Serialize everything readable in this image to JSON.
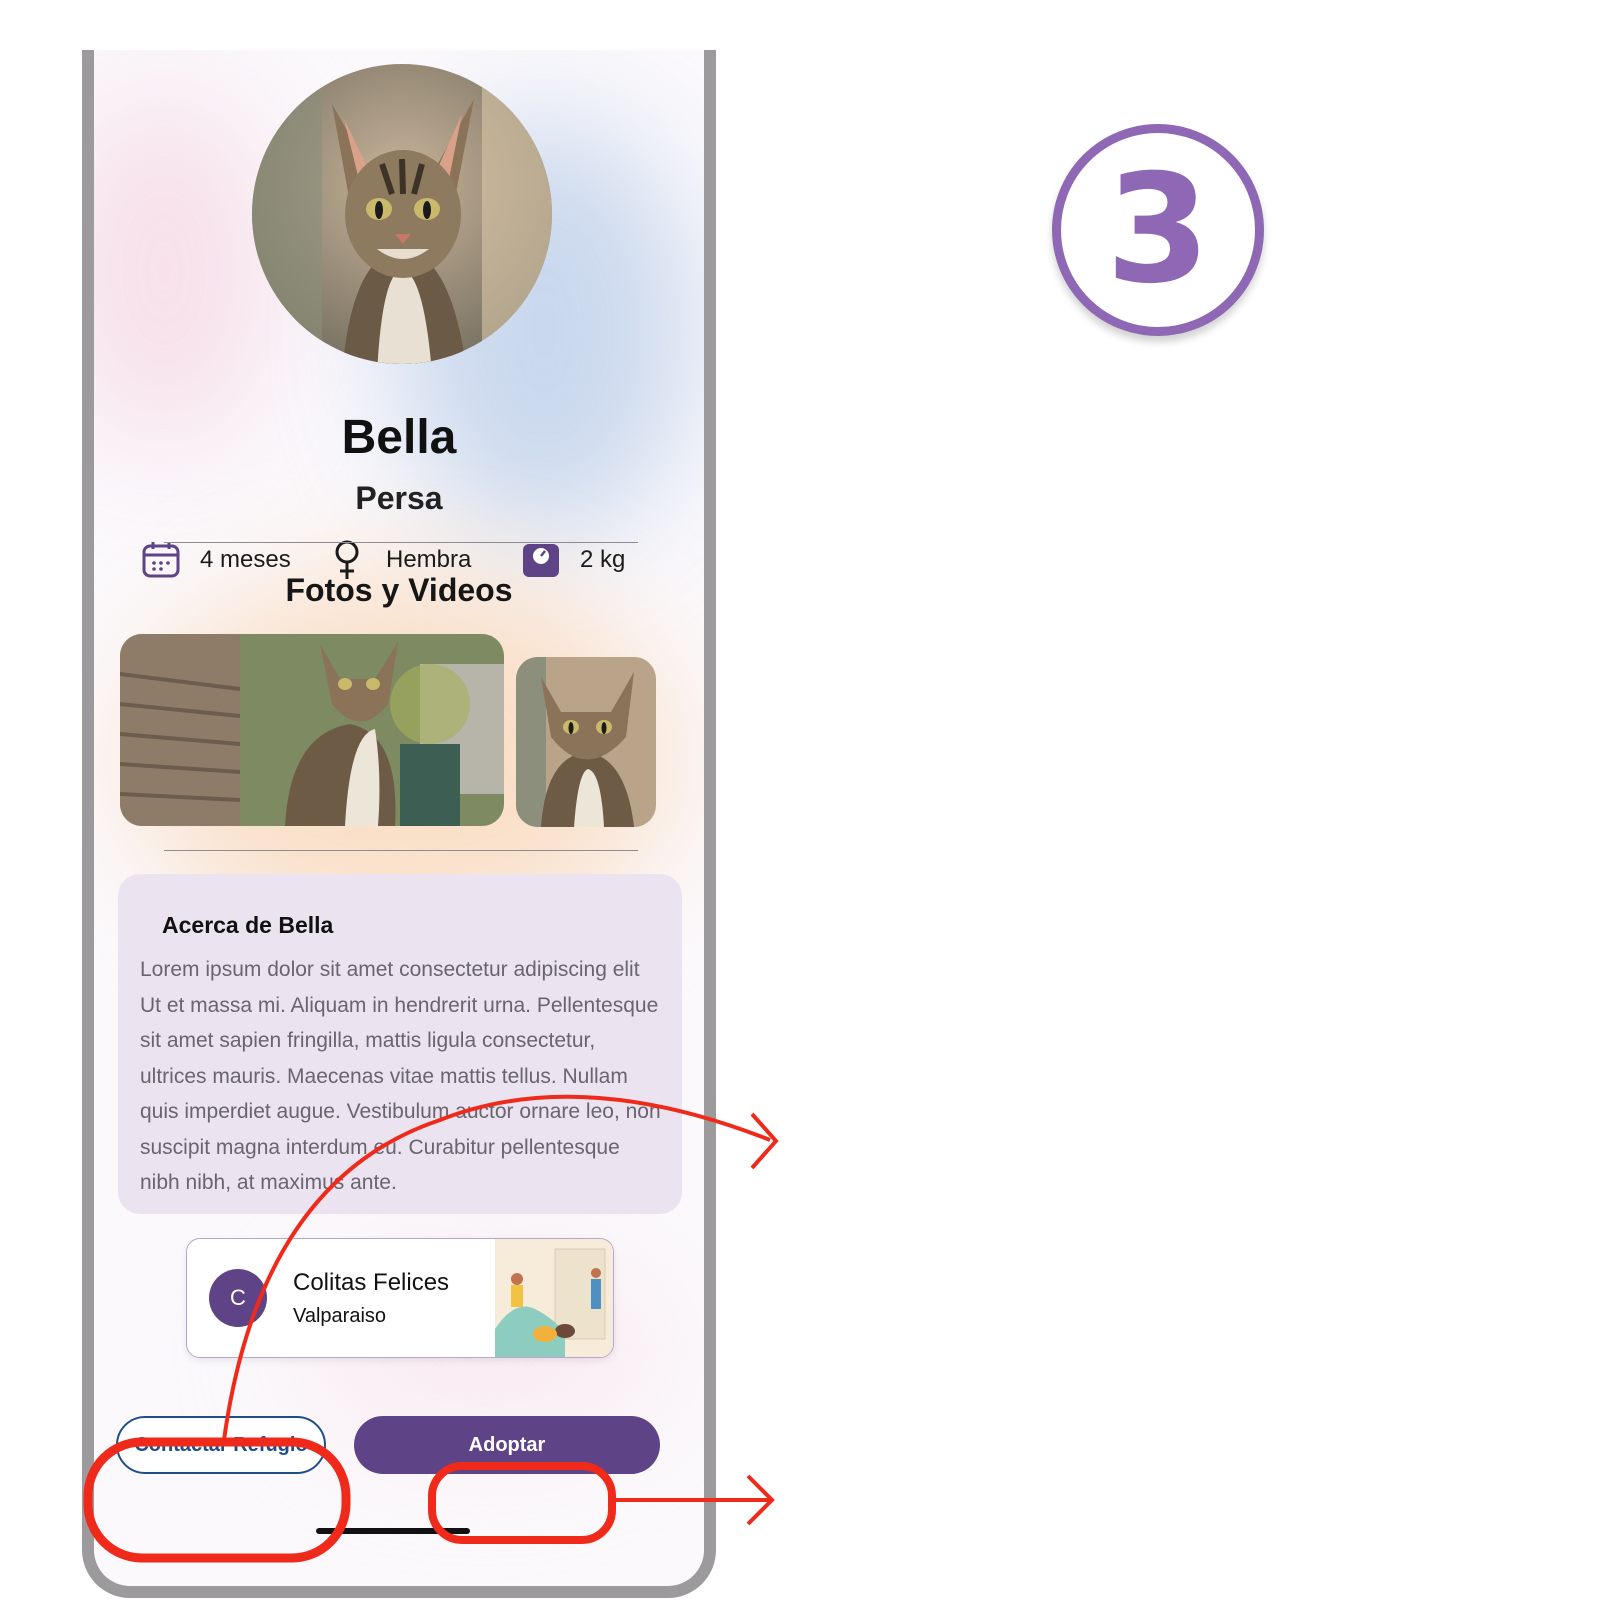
{
  "pet": {
    "name": "Bella",
    "breed": "Persa",
    "age": "4 meses",
    "sex": "Hembra",
    "weight": "2 kg"
  },
  "gallery": {
    "title": "Fotos y Videos"
  },
  "about": {
    "title": "Acerca de Bella",
    "text": "Lorem ipsum dolor sit amet consectetur adipiscing elit Ut et massa mi. Aliquam in hendrerit urna. Pellentesque sit amet sapien fringilla, mattis ligula consectetur, ultrices mauris. Maecenas vitae mattis tellus. Nullam quis imperdiet augue. Vestibulum auctor ornare leo, non suscipit magna interdum eu. Curabitur pellentesque nibh nibh, at maximus ante."
  },
  "shelter": {
    "initial": "C",
    "name": "Colitas Felices",
    "city": "Valparaiso"
  },
  "actions": {
    "contact_label": "Contactar Refugio",
    "adopt_label": "Adoptar"
  },
  "annotation": {
    "step_number": "3"
  },
  "colors": {
    "primary": "#5e4386",
    "accent_blue": "#1e4e8a",
    "annotation_red": "#f02a1a",
    "step_purple": "#8e68b5"
  },
  "icons": {
    "age": "calendar-icon",
    "sex": "female-icon",
    "weight": "scale-icon"
  }
}
